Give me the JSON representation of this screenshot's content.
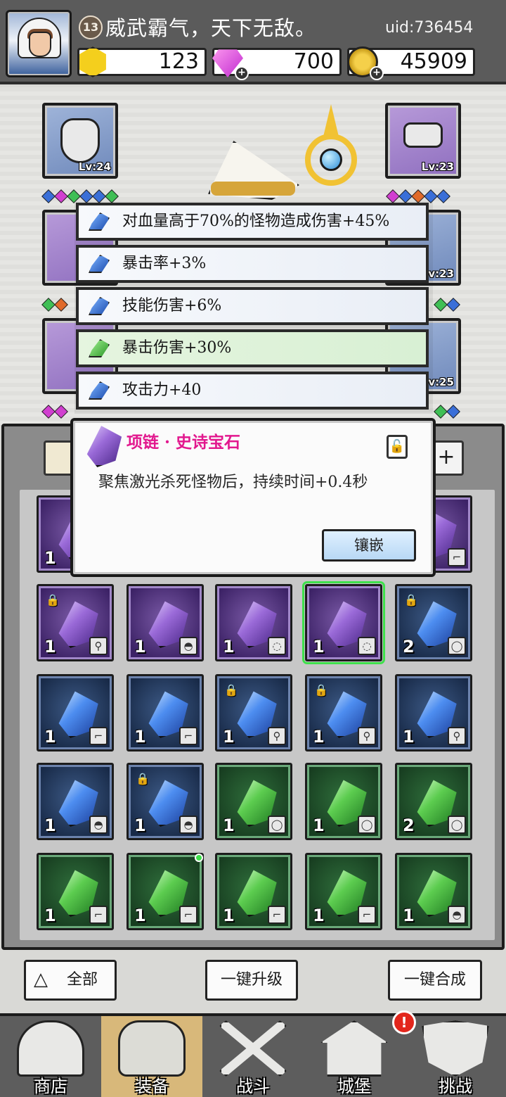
{
  "header": {
    "level": "13",
    "player_name": "威武霸气，天下无敌。",
    "uid": "uid:736454",
    "currencies": {
      "gold": "123",
      "gems": "700",
      "coins": "45909"
    }
  },
  "equipment": {
    "left_top_level": "Lv:24",
    "right_top_level": "Lv:23",
    "right_mid_level": "Lv:23",
    "right_bottom_level": "Lv:25"
  },
  "stats": [
    {
      "text": "对血量高于70%的怪物造成伤害+45%",
      "gem": "blue"
    },
    {
      "text": "暴击率+3%",
      "gem": "blue"
    },
    {
      "text": "技能伤害+6%",
      "gem": "blue"
    },
    {
      "text": "暴击伤害+30%",
      "gem": "green"
    },
    {
      "text": "攻击力+40",
      "gem": "blue"
    }
  ],
  "popup": {
    "title": "项链 · 史诗宝石",
    "description": "聚焦激光杀死怪物后，持续时间+0.4秒",
    "inlay_button": "镶嵌"
  },
  "inventory": {
    "add_button": "+",
    "top_row": [
      {
        "count": "1",
        "rarity": "purple"
      },
      {
        "count": "",
        "rarity": "purple"
      }
    ],
    "rows": [
      [
        {
          "count": "1",
          "rarity": "purple",
          "locked": true,
          "type": "sword"
        },
        {
          "count": "1",
          "rarity": "purple",
          "locked": false,
          "type": "hat"
        },
        {
          "count": "1",
          "rarity": "purple",
          "locked": false,
          "type": "necklace"
        },
        {
          "count": "1",
          "rarity": "purple",
          "locked": false,
          "type": "necklace",
          "selected": true
        },
        {
          "count": "2",
          "rarity": "blue",
          "locked": true,
          "type": "ring"
        }
      ],
      [
        {
          "count": "1",
          "rarity": "blue",
          "locked": false,
          "type": "boot"
        },
        {
          "count": "1",
          "rarity": "blue",
          "locked": false,
          "type": "boot"
        },
        {
          "count": "1",
          "rarity": "blue",
          "locked": true,
          "type": "sword"
        },
        {
          "count": "1",
          "rarity": "blue",
          "locked": true,
          "type": "sword"
        },
        {
          "count": "1",
          "rarity": "blue",
          "locked": false,
          "type": "sword"
        }
      ],
      [
        {
          "count": "1",
          "rarity": "blue",
          "locked": false,
          "type": "hat"
        },
        {
          "count": "1",
          "rarity": "blue",
          "locked": true,
          "type": "hat"
        },
        {
          "count": "1",
          "rarity": "green",
          "locked": false,
          "type": "ring"
        },
        {
          "count": "1",
          "rarity": "green",
          "locked": false,
          "type": "ring"
        },
        {
          "count": "2",
          "rarity": "green",
          "locked": false,
          "type": "ring"
        }
      ],
      [
        {
          "count": "1",
          "rarity": "green",
          "locked": false,
          "type": "boot"
        },
        {
          "count": "1",
          "rarity": "green",
          "locked": false,
          "type": "boot",
          "new": true
        },
        {
          "count": "1",
          "rarity": "green",
          "locked": false,
          "type": "boot"
        },
        {
          "count": "1",
          "rarity": "green",
          "locked": false,
          "type": "boot"
        },
        {
          "count": "1",
          "rarity": "green",
          "locked": false,
          "type": "hat"
        }
      ]
    ]
  },
  "actions": {
    "all": "全部",
    "upgrade_all": "一键升级",
    "merge_all": "一键合成"
  },
  "nav": {
    "shop": "商店",
    "equipment": "装备",
    "battle": "战斗",
    "castle": "城堡",
    "challenge": "挑战",
    "alert": "!"
  },
  "colors": {
    "title_pink": "#e2188e",
    "selected_green": "#3ee04b",
    "alert_red": "#e3261c"
  }
}
